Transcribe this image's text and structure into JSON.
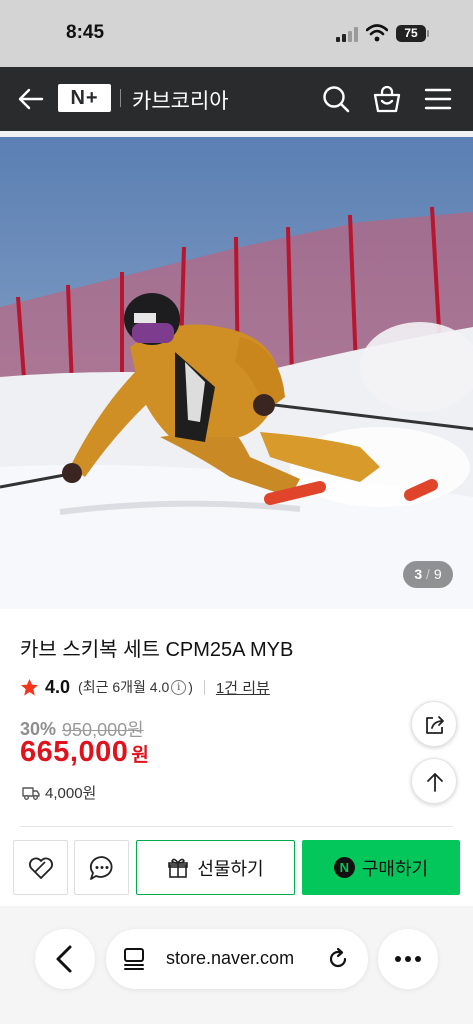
{
  "status_bar": {
    "time": "8:45",
    "battery": "75"
  },
  "header": {
    "logo_text": "N+",
    "store_name": "카브코리아"
  },
  "gallery": {
    "current": "3",
    "separator": "/",
    "total": "9"
  },
  "product": {
    "title": "카브 스키복 세트 CPM25A MYB",
    "rating": "4.0",
    "recent_rating_prefix": "(최근 6개월 4.0",
    "recent_rating_suffix": ")",
    "info_icon_glyph": "i",
    "review_count": "1건 리뷰",
    "discount_rate": "30%",
    "original_price": "950,000원",
    "price": "665,000",
    "price_unit": "원",
    "shipping_fee": "4,000원"
  },
  "actions": {
    "gift_label": "선물하기",
    "buy_label": "구매하기",
    "npay_glyph": "N"
  },
  "browser": {
    "url": "store.naver.com"
  },
  "colors": {
    "header_bg": "#2a2b2d",
    "price_red": "#e0131d",
    "naver_green": "#03c75a",
    "star_red": "#f2361c"
  },
  "icons": [
    "back-arrow-icon",
    "search-icon",
    "cart-icon",
    "menu-icon",
    "star-icon",
    "info-icon",
    "truck-icon",
    "share-icon",
    "arrow-up-icon",
    "heart-icon",
    "chat-icon",
    "gift-icon",
    "npay-icon",
    "browser-back-icon",
    "tabs-icon",
    "reload-icon",
    "more-icon"
  ]
}
